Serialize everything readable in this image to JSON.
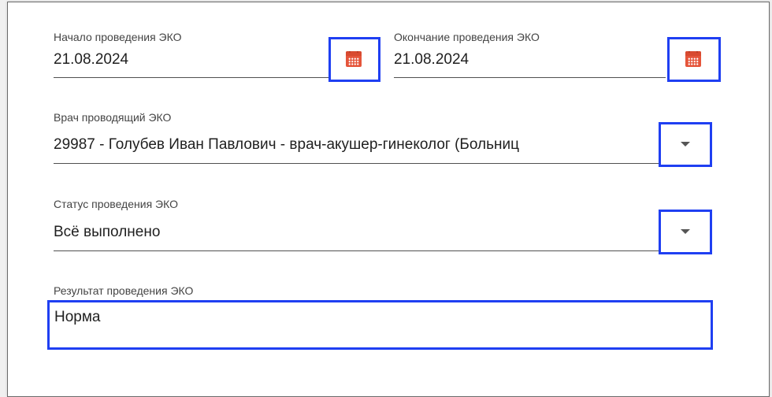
{
  "form": {
    "start_date": {
      "label": "Начало проведения ЭКО",
      "value": "21.08.2024",
      "icon": "calendar-icon"
    },
    "end_date": {
      "label": "Окончание проведения ЭКО",
      "value": "21.08.2024",
      "icon": "calendar-icon"
    },
    "doctor": {
      "label": "Врач проводящий ЭКО",
      "value": "29987 - Голубев Иван Павлович - врач-акушер-гинеколог (Больниц",
      "icon": "chevron-down-icon"
    },
    "status": {
      "label": "Статус проведения ЭКО",
      "value": "Всё выполнено",
      "icon": "chevron-down-icon"
    },
    "result": {
      "label": "Результат проведения ЭКО",
      "value": "Норма"
    }
  },
  "colors": {
    "highlight": "#1f3ff2",
    "calendar_icon": "#e5553b",
    "underline": "#505050"
  }
}
